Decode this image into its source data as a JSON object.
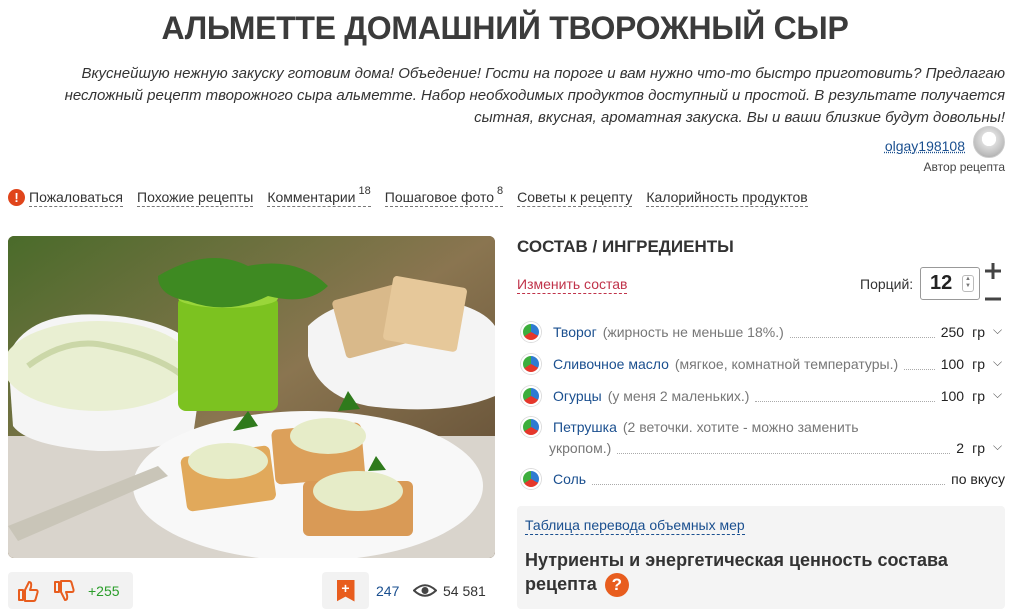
{
  "title": "АЛЬМЕТТЕ ДОМАШНИЙ ТВОРОЖНЫЙ СЫР",
  "intro": "Вкуснейшую нежную закуску готовим дома! Объедение! Гости на пороге и вам нужно что-то быстро приготовить? Предлагаю несложный рецепт творожного сыра альметте. Набор необходимых продуктов доступный и простой. В результате получается сытная, вкусная, ароматная закуска. Вы и ваши близкие будут довольны!",
  "author": {
    "name": "olgay198108",
    "role": "Автор рецепта"
  },
  "nav": {
    "complain": "Пожаловаться",
    "similar": "Похожие рецепты",
    "comments": "Комментарии",
    "comments_count": "18",
    "step_photo": "Пошаговое фото",
    "step_photo_count": "8",
    "tips": "Советы к рецепту",
    "calories": "Калорийность продуктов"
  },
  "votes": {
    "count": "+255"
  },
  "stats": {
    "saves": "247",
    "views": "54 581"
  },
  "ingredients": {
    "title": "СОСТАВ / ИНГРЕДИЕНТЫ",
    "change_label": "Изменить состав",
    "portions_label": "Порций:",
    "portions_value": "12",
    "items": [
      {
        "name": "Творог",
        "note": "(жирность не меньше 18%.)",
        "qty": "250",
        "unit": "гр"
      },
      {
        "name": "Сливочное масло",
        "note": "(мягкое, комнатной температуры.)",
        "qty": "100",
        "unit": "гр"
      },
      {
        "name": "Огурцы",
        "note": "(у меня 2 маленьких.)",
        "qty": "100",
        "unit": "гр"
      },
      {
        "name": "Петрушка",
        "note": "(2 веточки. хотите - можно заменить",
        "note2": "укропом.)",
        "qty": "2",
        "unit": "гр"
      },
      {
        "name": "Соль",
        "note": "",
        "qty": "по вкусу",
        "unit": ""
      }
    ]
  },
  "measures_link": "Таблица перевода объемных мер",
  "nutrients_title": "Нутриенты и энергетическая ценность состава рецепта",
  "colors": {
    "accent": "#e85d1e",
    "link": "#1a4f8f",
    "change": "#c0334a",
    "positive": "#2a9d2a"
  }
}
